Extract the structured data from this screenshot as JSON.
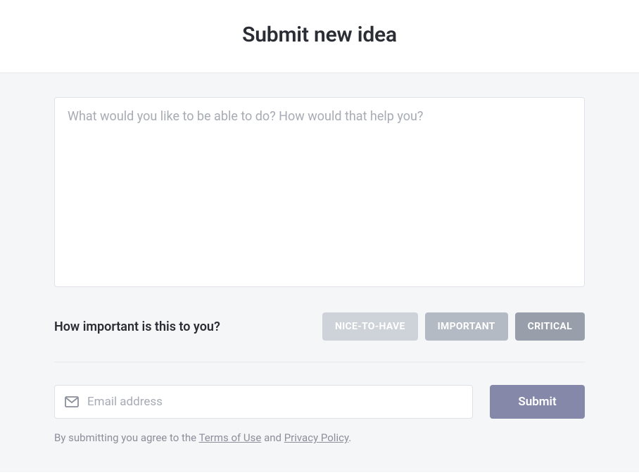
{
  "header": {
    "title": "Submit new idea"
  },
  "form": {
    "idea_placeholder": "What would you like to be able to do? How would that help you?",
    "idea_value": ""
  },
  "importance": {
    "label": "How important is this to you?",
    "options": [
      "NICE-TO-HAVE",
      "IMPORTANT",
      "CRITICAL"
    ]
  },
  "email": {
    "placeholder": "Email address",
    "value": ""
  },
  "submit": {
    "label": "Submit"
  },
  "disclaimer": {
    "prefix": "By submitting you agree to the ",
    "terms_label": "Terms of Use",
    "middle": " and ",
    "privacy_label": "Privacy Policy",
    "suffix": "."
  }
}
